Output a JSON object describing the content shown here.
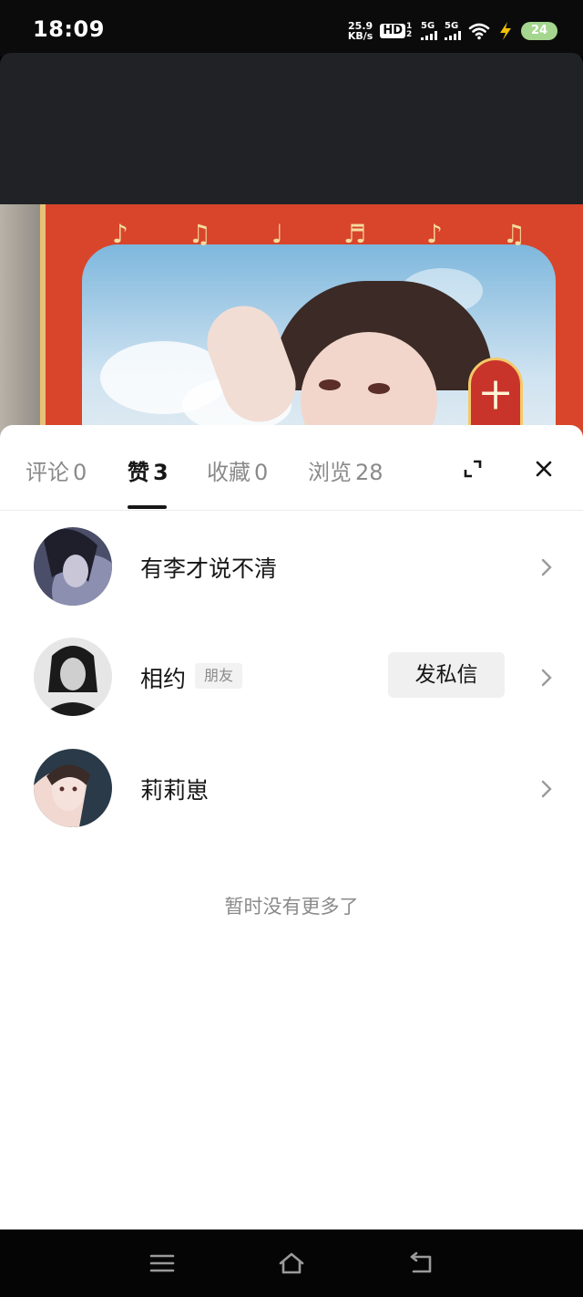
{
  "status_bar": {
    "time": "18:09",
    "net_speed_value": "25.9",
    "net_speed_unit": "KB/s",
    "hd_label": "HD",
    "hd_sub": "1 2",
    "sim1_label": "5G",
    "sim2_label": "5G",
    "battery_level": "24",
    "battery_color": "#a5d68f",
    "charging_color": "#f2c100"
  },
  "sheet": {
    "tabs": [
      {
        "label": "评论",
        "count": "0",
        "active": false
      },
      {
        "label": "赞",
        "count": "3",
        "active": true
      },
      {
        "label": "收藏",
        "count": "0",
        "active": false
      },
      {
        "label": "浏览",
        "count": "28",
        "active": false
      }
    ],
    "icons": {
      "expand": "expand-icon",
      "close": "close-icon"
    },
    "likers": [
      {
        "name": "有李才说不清",
        "tag": "",
        "action": ""
      },
      {
        "name": "相约",
        "tag": "朋友",
        "action": "发私信"
      },
      {
        "name": "莉莉崽",
        "tag": "",
        "action": ""
      }
    ],
    "end_text": "暂时没有更多了"
  },
  "nav_bar": {
    "icons": [
      "menu-icon",
      "home-icon",
      "back-icon"
    ]
  },
  "poster": {
    "badge_char": "十"
  }
}
